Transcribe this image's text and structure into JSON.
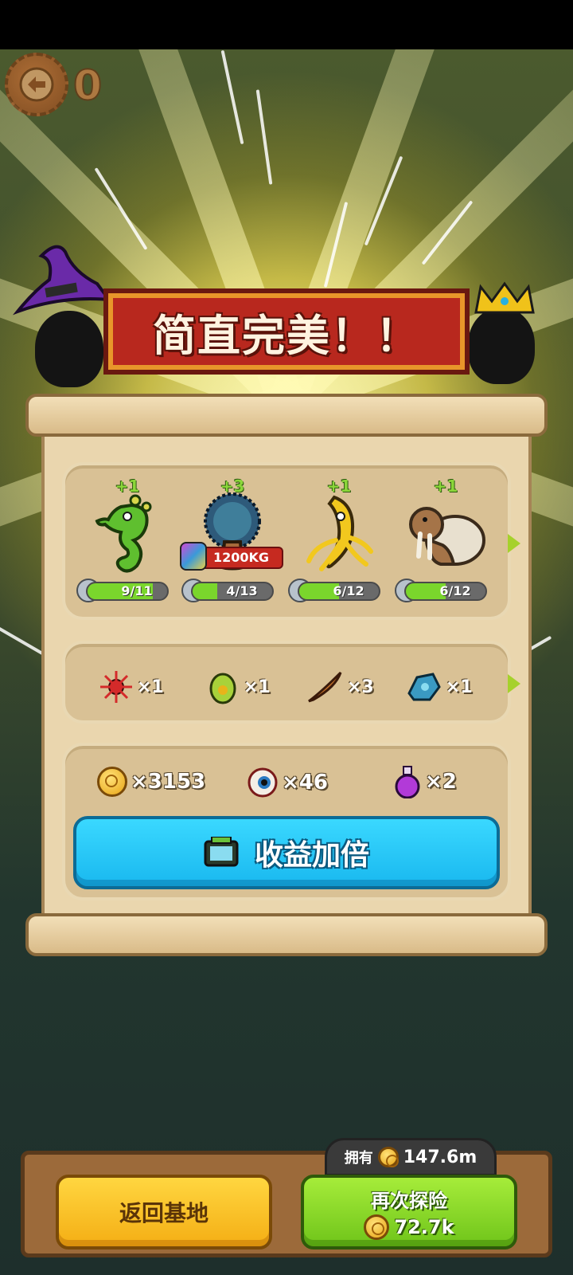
{
  "header": {
    "back_button_icon": "back-arrow-icon",
    "counter": "0"
  },
  "banner": {
    "title": "简直完美！！"
  },
  "monsters": [
    {
      "name": "seahorse",
      "bonus": "+1",
      "count": "9/11",
      "progress": 0.82,
      "color": "#5fbf2f"
    },
    {
      "name": "hairy-tree",
      "bonus": "+3",
      "count": "4/13",
      "progress": 0.31,
      "weight": "1200KG",
      "color": "#2e5a7a"
    },
    {
      "name": "banana-squid",
      "bonus": "+1",
      "count": "6/12",
      "progress": 0.5,
      "color": "#f2c81e"
    },
    {
      "name": "walrus",
      "bonus": "+1",
      "count": "6/12",
      "progress": 0.5,
      "color": "#a57448"
    }
  ],
  "items": [
    {
      "icon": "red-spiky-icon",
      "qty": "×1"
    },
    {
      "icon": "green-egg-icon",
      "qty": "×1"
    },
    {
      "icon": "feather-icon",
      "qty": "×3"
    },
    {
      "icon": "blue-device-icon",
      "qty": "×1"
    }
  ],
  "rewards": [
    {
      "icon": "coin-icon",
      "qty": "×3153"
    },
    {
      "icon": "eyeball-icon",
      "qty": "×46"
    },
    {
      "icon": "potion-icon",
      "qty": "×2"
    }
  ],
  "double_button": {
    "label": "收益加倍",
    "icon": "tv-ad-icon"
  },
  "bottom": {
    "owned_label": "拥有",
    "owned_value": "147.6m",
    "return_label": "返回基地",
    "again_label": "再次探险",
    "again_cost": "72.7k"
  }
}
